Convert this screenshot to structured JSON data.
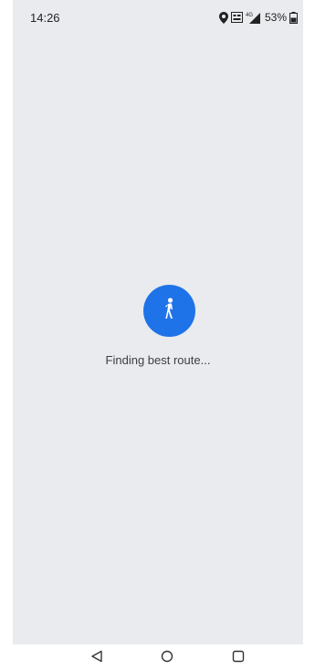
{
  "status_bar": {
    "time": "14:26",
    "battery": "53%",
    "icons": [
      "location-icon",
      "data-saver-icon",
      "signal-icon",
      "battery-icon"
    ]
  },
  "main": {
    "mode_icon": "walking-person-icon",
    "loading_text": "Finding best route..."
  },
  "nav_bar": {
    "icons": [
      "back-triangle-icon",
      "home-circle-icon",
      "recents-square-icon"
    ]
  },
  "colors": {
    "accent": "#1f73e8",
    "background": "#e9ebef",
    "text": "#3c4043"
  }
}
